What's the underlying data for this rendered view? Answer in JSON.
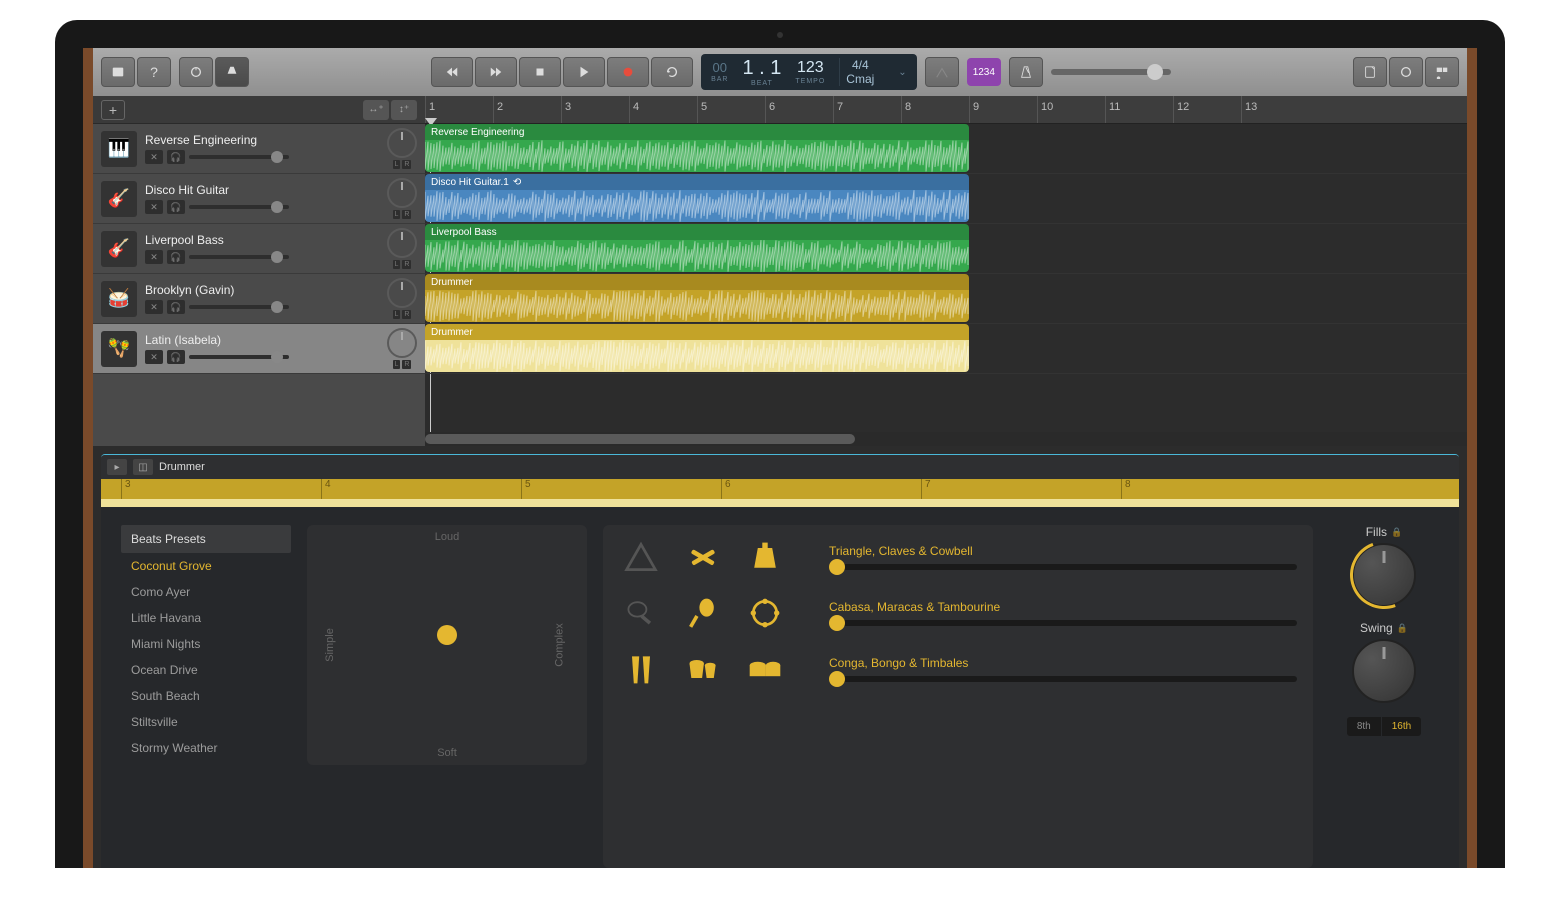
{
  "toolbar": {
    "lcd": {
      "bar": "00",
      "beat_big": "1 . 1",
      "beat_lbl": "BEAT",
      "bar_lbl": "BAR",
      "tempo": "123",
      "tempo_lbl": "TEMPO",
      "sig": "4/4",
      "key": "Cmaj"
    },
    "count_in": "1234"
  },
  "ruler_marks": [
    "1",
    "2",
    "3",
    "4",
    "5",
    "6",
    "7",
    "8",
    "9",
    "10",
    "11",
    "12",
    "13"
  ],
  "tracks": [
    {
      "name": "Reverse Engineering",
      "icon": "🎹",
      "selected": false
    },
    {
      "name": "Disco Hit Guitar",
      "icon": "🎸",
      "selected": false
    },
    {
      "name": "Liverpool Bass",
      "icon": "🎸",
      "selected": false
    },
    {
      "name": "Brooklyn (Gavin)",
      "icon": "🥁",
      "selected": false
    },
    {
      "name": "Latin (Isabela)",
      "icon": "🪇",
      "selected": true
    }
  ],
  "regions": [
    {
      "label": "Reverse Engineering",
      "color": "green",
      "loop": false
    },
    {
      "label": "Disco Hit Guitar.1",
      "color": "blue",
      "loop": true
    },
    {
      "label": "Liverpool Bass",
      "color": "green",
      "loop": false
    },
    {
      "label": "Drummer",
      "color": "yellow",
      "loop": false
    },
    {
      "label": "Drummer",
      "color": "yellow",
      "loop": false,
      "selected": true
    }
  ],
  "editor": {
    "tab_label": "Drummer",
    "ruler_marks": [
      "3",
      "4",
      "5",
      "6",
      "7",
      "8"
    ],
    "presets_header": "Beats Presets",
    "presets": [
      "Coconut Grove",
      "Como Ayer",
      "Little Havana",
      "Miami Nights",
      "Ocean Drive",
      "South Beach",
      "Stiltsville",
      "Stormy Weather"
    ],
    "preset_selected": 0,
    "xy": {
      "top": "Loud",
      "bottom": "Soft",
      "left": "Simple",
      "right": "Complex"
    },
    "kit_groups": [
      {
        "name": "Triangle, Claves & Cowbell",
        "icons": [
          "triangle",
          "claves",
          "cowbell"
        ],
        "states": [
          false,
          true,
          true
        ]
      },
      {
        "name": "Cabasa, Maracas & Tambourine",
        "icons": [
          "cabasa",
          "maracas",
          "tambourine"
        ],
        "states": [
          false,
          true,
          true
        ]
      },
      {
        "name": "Conga, Bongo & Timbales",
        "icons": [
          "conga",
          "bongo",
          "timbales"
        ],
        "states": [
          true,
          true,
          true
        ]
      }
    ],
    "knobs": {
      "fills": "Fills",
      "swing": "Swing",
      "seg_8": "8th",
      "seg_16": "16th"
    }
  }
}
